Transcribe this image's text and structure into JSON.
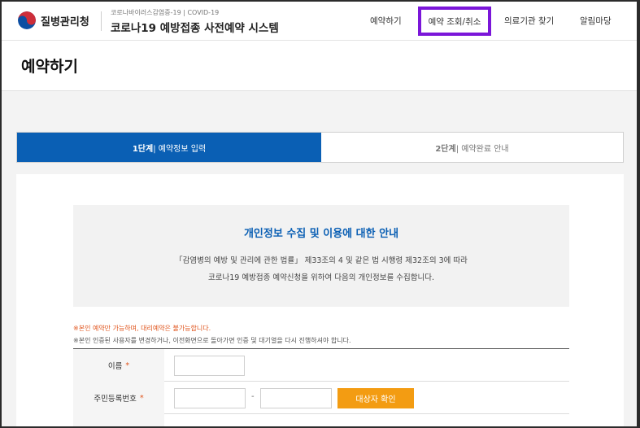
{
  "header": {
    "org_name": "질병관리청",
    "system_subtitle": "코로나바이러스감염증-19 | COVID-19",
    "system_title": "코로나19 예방접종 사전예약 시스템",
    "nav": [
      {
        "label": "예약하기"
      },
      {
        "label": "예약 조회/취소"
      },
      {
        "label": "의료기관 찾기"
      },
      {
        "label": "알림마당"
      }
    ]
  },
  "page": {
    "title": "예약하기"
  },
  "steps": [
    {
      "num": "1단계",
      "label": " | 예약정보 입력",
      "active": true
    },
    {
      "num": "2단계",
      "label": " | 예약완료 안내",
      "active": false
    }
  ],
  "notice": {
    "title": "개인정보 수집 및 이용에 대한 안내",
    "line1": "「감염병의 예방 및 관리에 관한 법률」 제33조의 4 및 같은 법 시행령 제32조의 3에 따라",
    "line2": "코로나19 예방접종 예약신청을 위하여 다음의 개인정보를 수집합니다."
  },
  "warnings": {
    "w1": "※본인 예약만 가능하며, 대리예약은 불가능합니다.",
    "w2": "※본인 인증된 사용자를 변경하거나, 이전화면으로 돌아가면 인증 및 대기열을 다시 진행하셔야 합니다."
  },
  "form": {
    "name_label": "이름",
    "rrn_label": "주민등록번호",
    "required_mark": "*",
    "name_value": "",
    "rrn_front_value": "",
    "rrn_back_value": "",
    "dash": "-",
    "confirm_button": "대상자 확인"
  },
  "colors": {
    "brand_blue": "#0a5fb4",
    "highlight_purple": "#7b16d9",
    "accent_orange": "#f39c12",
    "warning_red": "#e0541c"
  }
}
